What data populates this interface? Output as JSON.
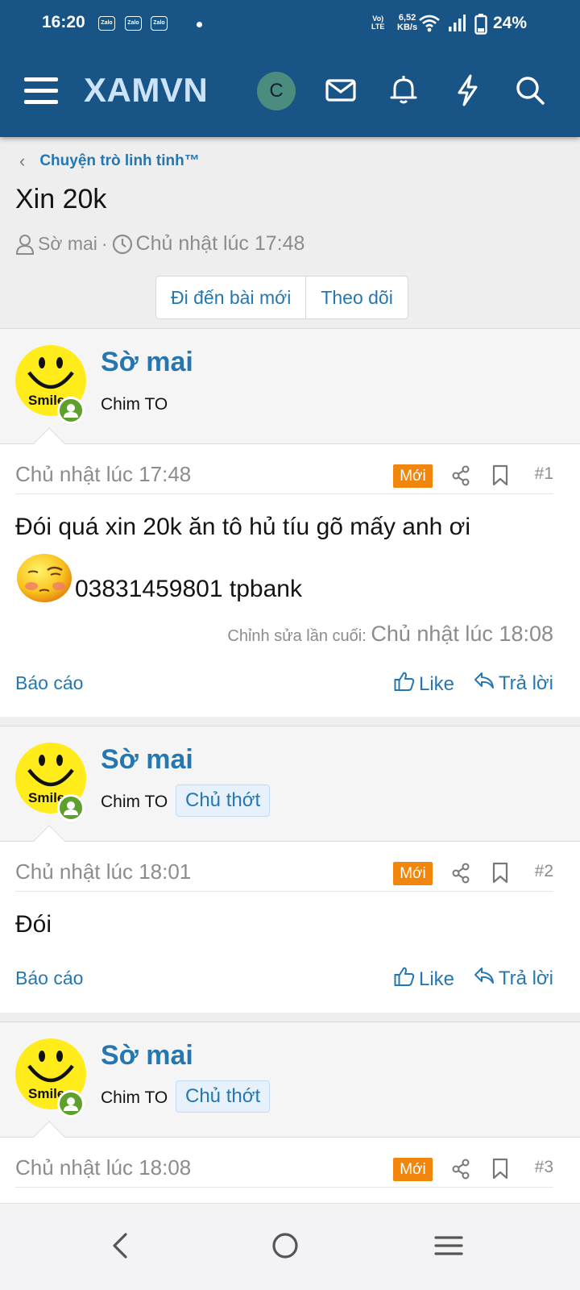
{
  "status_bar": {
    "time": "16:20",
    "notif_icons": [
      "Zalo",
      "Zalo",
      "Zalo"
    ],
    "volte": "Vo)\nLTE",
    "net_speed": "6,52\nKB/s",
    "battery": "24%"
  },
  "header": {
    "logo": "XAMVN",
    "avatar_letter": "C"
  },
  "thread": {
    "breadcrumb": "Chuyện trò linh tinh™",
    "title": "Xin 20k",
    "author": "Sờ mai",
    "separator": "·",
    "date": "Chủ nhật lúc 17:48",
    "goto_new_label": "Đi đến bài mới",
    "follow_label": "Theo dõi"
  },
  "labels": {
    "new_badge": "Mới",
    "report": "Báo cáo",
    "like": "Like",
    "reply": "Trả lời",
    "edited_prefix": "Chỉnh sửa lần cuối:",
    "smiley_text": "Smile"
  },
  "posts": [
    {
      "username": "Sờ mai",
      "user_title": "Chim TO",
      "badge": "",
      "date": "Chủ nhật lúc 17:48",
      "number": "#1",
      "text_line1": "Đói quá xin 20k ăn tô hủ tíu gõ mấy anh ơi",
      "text_line2": "03831459801 tpbank",
      "edited_date": "Chủ nhật lúc 18:08"
    },
    {
      "username": "Sờ mai",
      "user_title": "Chim TO",
      "badge": "Chủ thớt",
      "date": "Chủ nhật lúc 18:01",
      "number": "#2",
      "text_line1": "Đói"
    },
    {
      "username": "Sờ mai",
      "user_title": "Chim TO",
      "badge": "Chủ thớt",
      "date": "Chủ nhật lúc 18:08",
      "number": "#3"
    }
  ],
  "colors": {
    "header_bg": "#185486",
    "link": "#2577b1",
    "new_badge": "#f0870c",
    "online": "#5ea02b"
  },
  "icons": {
    "header": [
      "menu-icon",
      "avatar",
      "envelope-icon",
      "bell-icon",
      "lightning-icon",
      "search-icon"
    ],
    "post": [
      "share-icon",
      "bookmark-icon",
      "thumbs-up-icon",
      "reply-icon"
    ],
    "nav": [
      "back-icon",
      "home-icon",
      "recents-icon"
    ]
  }
}
